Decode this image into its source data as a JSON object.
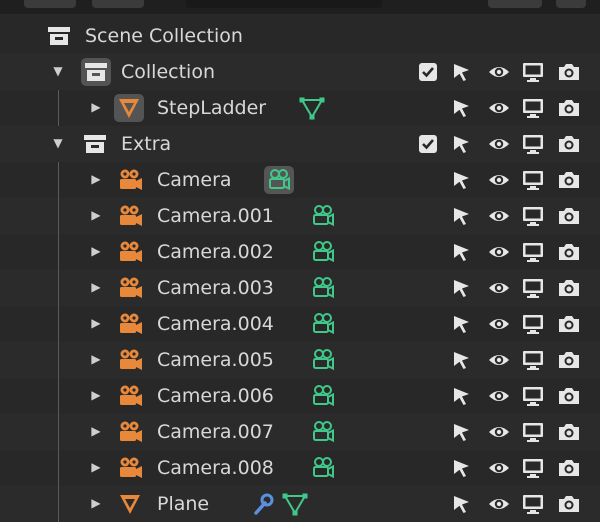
{
  "colors": {
    "bg": "#282828",
    "row_alt": "#2b2b2b",
    "text": "#d8d8d8",
    "object_orange": "#e8883a",
    "data_green": "#3fc88a",
    "modifier_blue": "#5b8fe0",
    "icon_white": "#e6e6e6"
  },
  "outliner": {
    "scene_collection": {
      "label": "Scene Collection",
      "icon": "collection-icon"
    },
    "collections": [
      {
        "label": "Collection",
        "icon": "collection-icon",
        "expanded": true,
        "exclude_checked": true,
        "children": [
          {
            "label": "StepLadder",
            "icon": "mesh-object-icon",
            "data_icon": "mesh-data-icon"
          }
        ]
      },
      {
        "label": "Extra",
        "icon": "collection-icon",
        "expanded": true,
        "exclude_checked": true,
        "children": [
          {
            "label": "Camera",
            "icon": "camera-object-icon",
            "data_icon": "camera-data-icon"
          },
          {
            "label": "Camera.001",
            "icon": "camera-object-icon",
            "data_icon": "camera-data-icon"
          },
          {
            "label": "Camera.002",
            "icon": "camera-object-icon",
            "data_icon": "camera-data-icon"
          },
          {
            "label": "Camera.003",
            "icon": "camera-object-icon",
            "data_icon": "camera-data-icon"
          },
          {
            "label": "Camera.004",
            "icon": "camera-object-icon",
            "data_icon": "camera-data-icon"
          },
          {
            "label": "Camera.005",
            "icon": "camera-object-icon",
            "data_icon": "camera-data-icon"
          },
          {
            "label": "Camera.006",
            "icon": "camera-object-icon",
            "data_icon": "camera-data-icon"
          },
          {
            "label": "Camera.007",
            "icon": "camera-object-icon",
            "data_icon": "camera-data-icon"
          },
          {
            "label": "Camera.008",
            "icon": "camera-object-icon",
            "data_icon": "camera-data-icon"
          },
          {
            "label": "Plane",
            "icon": "mesh-object-icon",
            "data_icon": "mesh-data-icon",
            "modifier_icon": "wrench-icon"
          }
        ]
      }
    ],
    "restriction_icons": [
      "checkbox-icon",
      "select-arrow-icon",
      "eye-icon",
      "monitor-icon",
      "render-camera-icon"
    ]
  }
}
